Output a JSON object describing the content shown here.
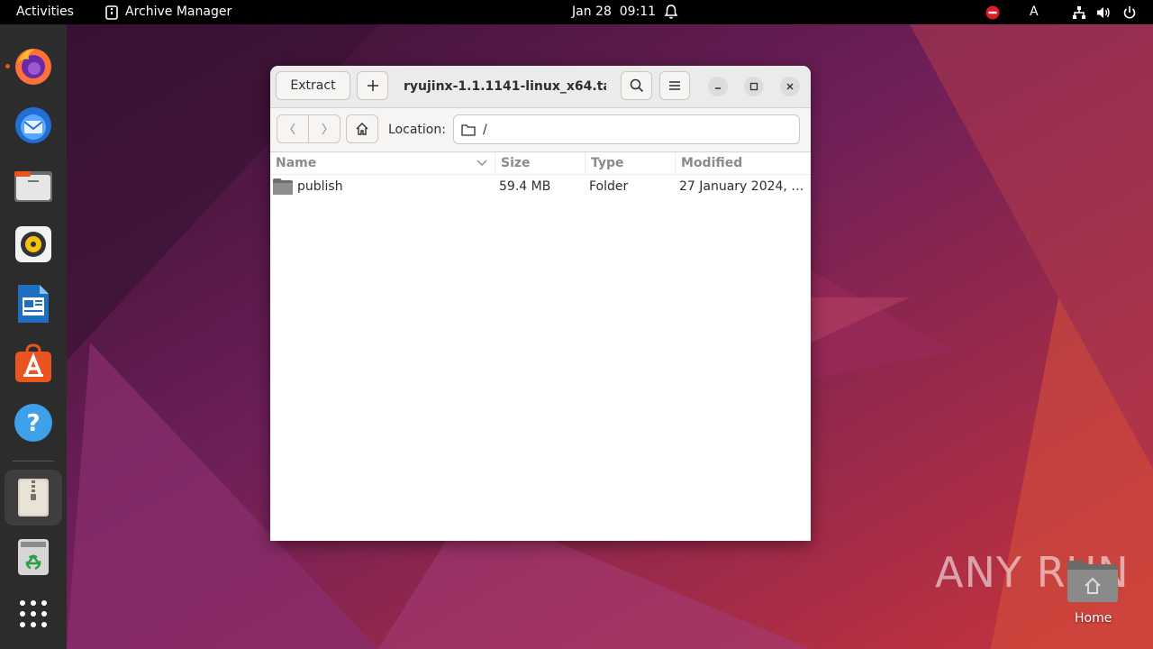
{
  "topbar": {
    "activities": "Activities",
    "app_name": "Archive Manager",
    "clock": "Jan 28  09:11",
    "keyboard": "A"
  },
  "dock": {
    "items": [
      "firefox-icon",
      "thunderbird-icon",
      "files-icon",
      "rhythmbox-icon",
      "libreoffice-writer-icon",
      "app-center-icon",
      "help-icon",
      "archive-manager-icon",
      "trash-icon",
      "show-apps-icon"
    ],
    "running": [
      "firefox",
      "archive-manager"
    ]
  },
  "window": {
    "extract_label": "Extract",
    "title": "ryujinx-1.1.1141-linux_x64.tar....",
    "location_label": "Location:",
    "location_value": "/",
    "columns": [
      "Name",
      "Size",
      "Type",
      "Modified"
    ],
    "rows": [
      {
        "name": "publish",
        "size": "59.4 MB",
        "type": "Folder",
        "modified": "27 January 2024, 1..."
      }
    ]
  },
  "desktop": {
    "watermark": "ANY RUN",
    "home_label": "Home"
  },
  "colors": {
    "accent": "#e95420",
    "topbar": "#000000",
    "dock": "#2c2c2c"
  }
}
